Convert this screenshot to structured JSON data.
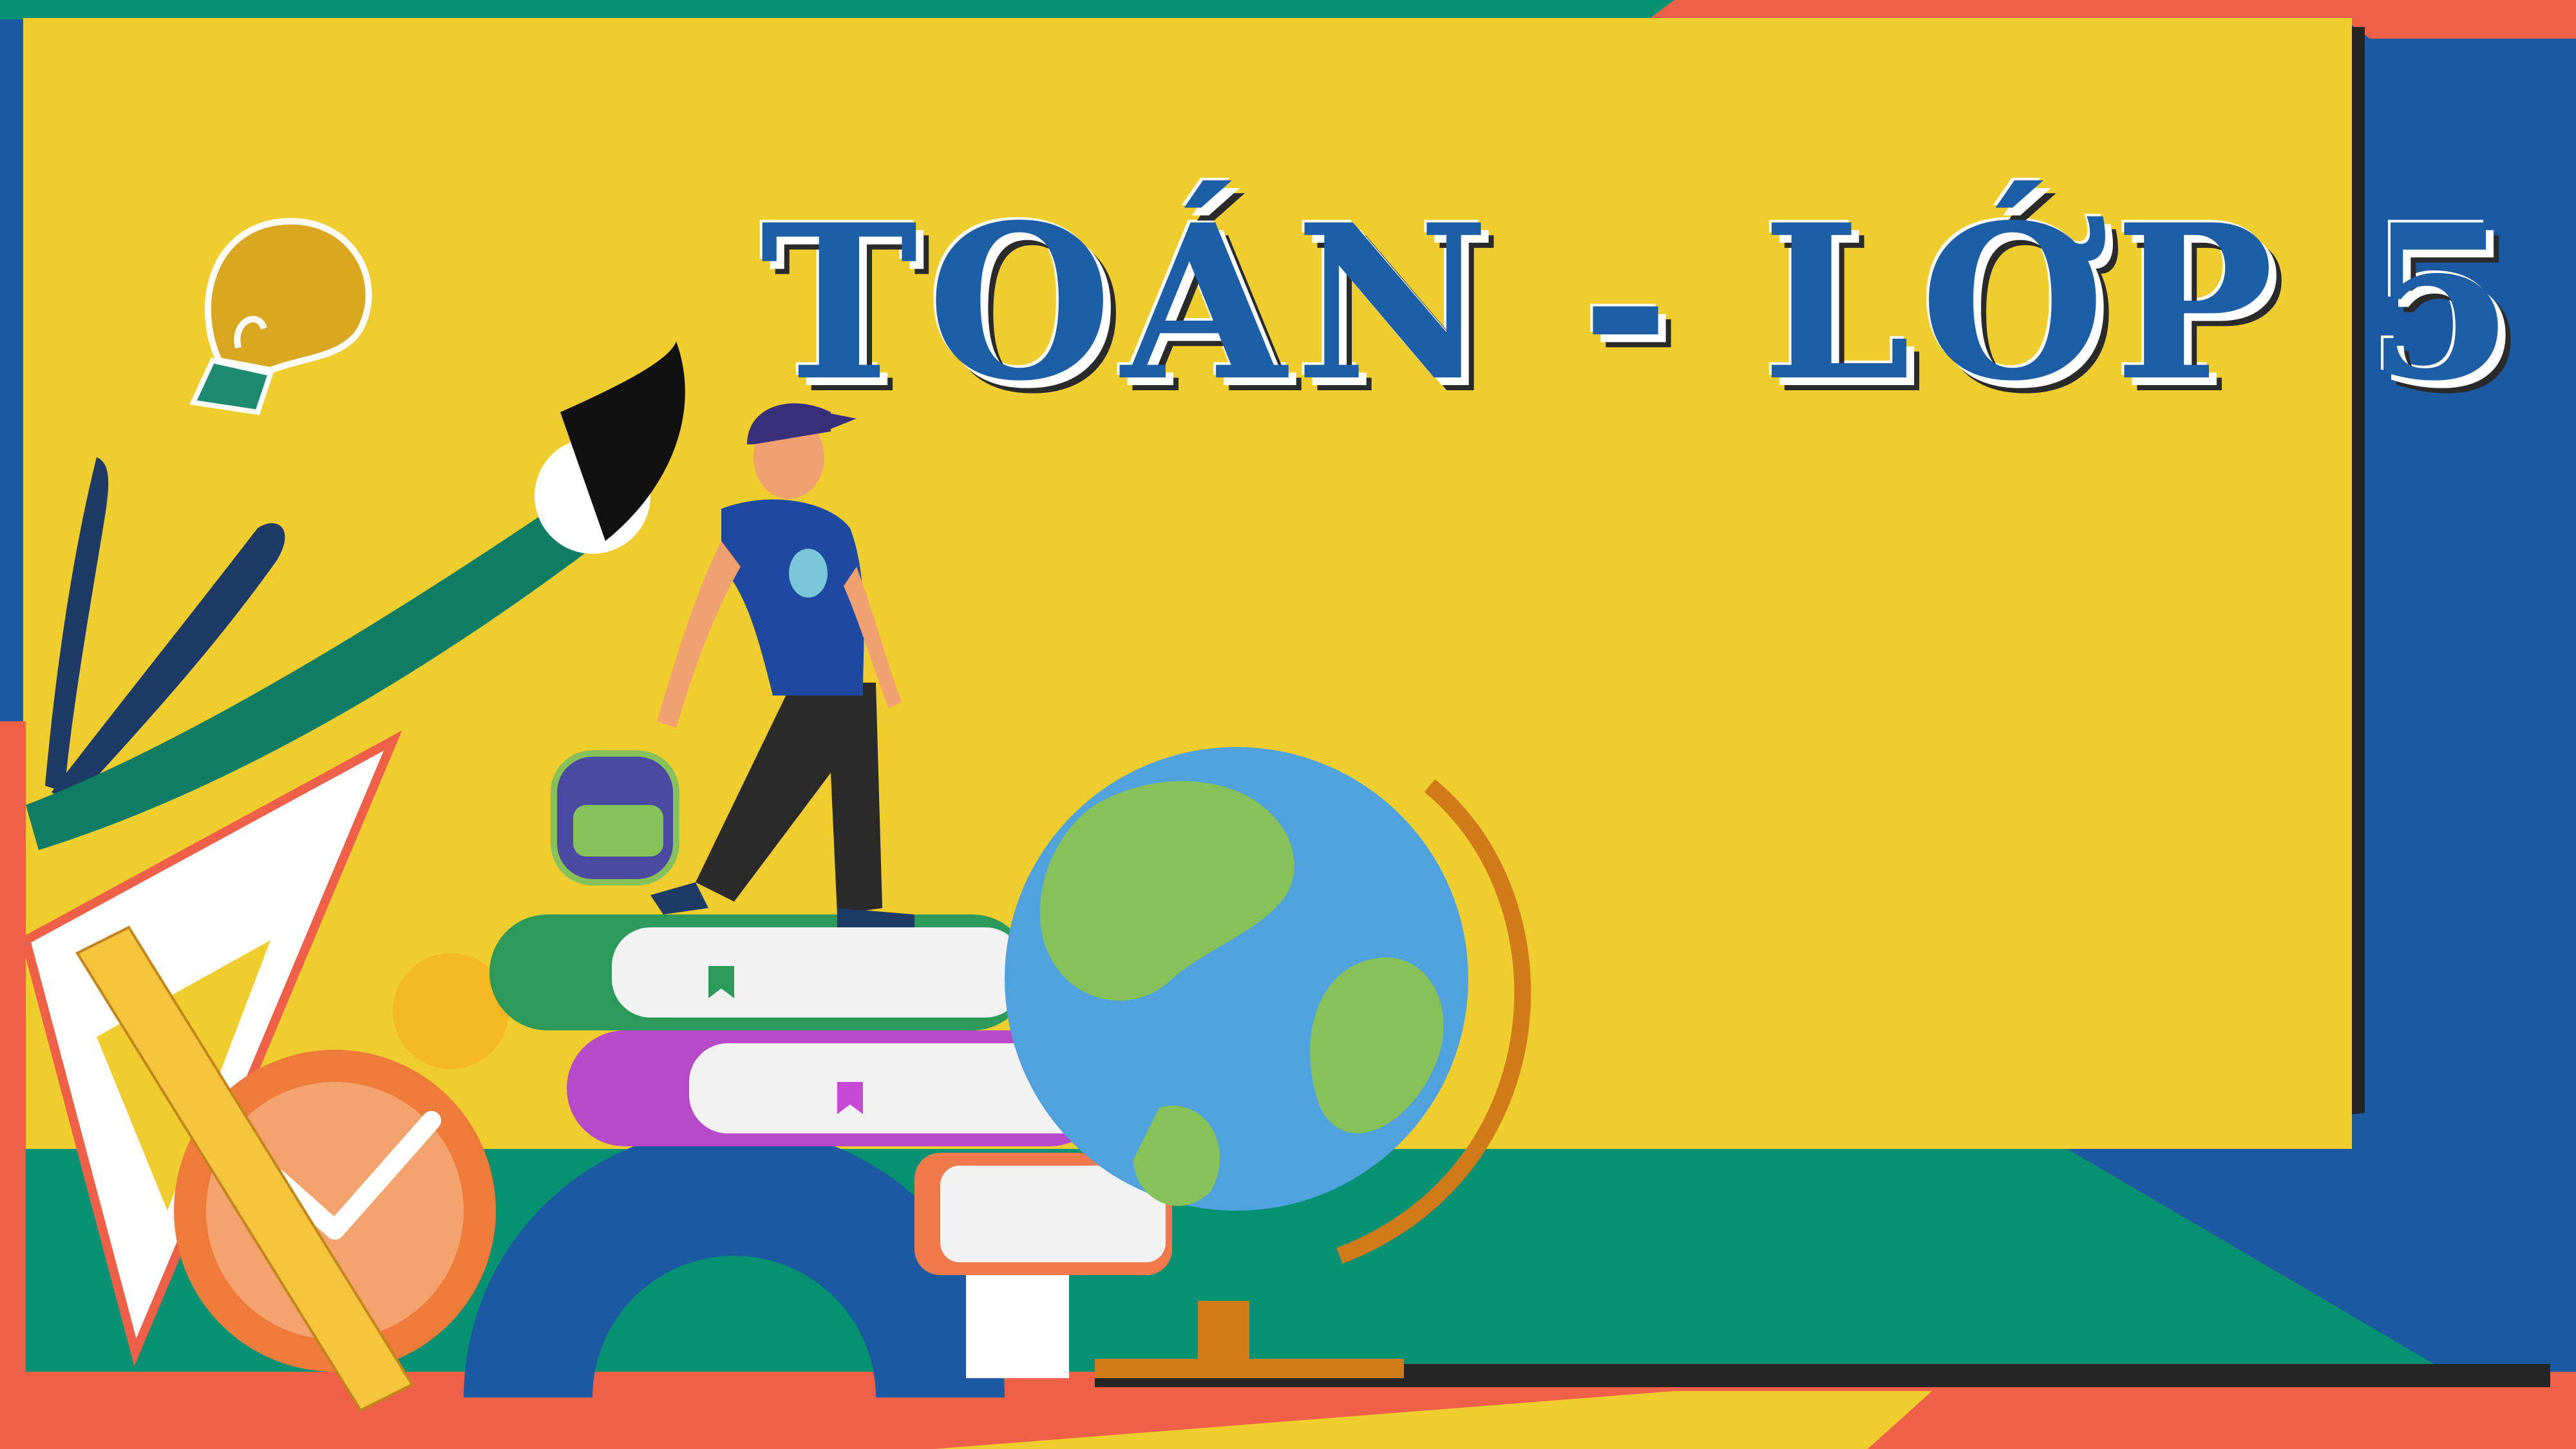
{
  "slide": {
    "title": "TOÁN - LỚP 5"
  },
  "colors": {
    "board_yellow": "#f0cd2e",
    "frame_blue": "#1b5aa0",
    "floor_teal": "#069173",
    "accent_coral": "#ef6048",
    "title_blue": "#1c5fa6"
  },
  "illustrations": [
    "lightbulb-icon",
    "paintbrush",
    "scissors",
    "student-walking",
    "backpack",
    "book-stack",
    "globe",
    "alarm-clock",
    "protractor",
    "set-square",
    "ruler"
  ]
}
